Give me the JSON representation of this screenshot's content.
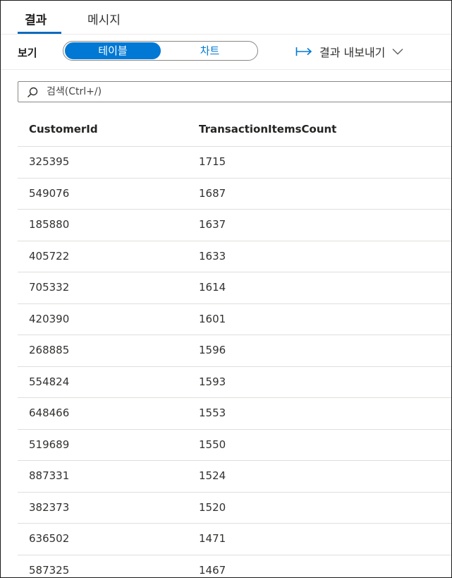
{
  "tabs": [
    {
      "label": "결과",
      "active": true
    },
    {
      "label": "메시지",
      "active": false
    }
  ],
  "toolbar": {
    "view_label": "보기",
    "view_options": [
      {
        "label": "테이블",
        "selected": true
      },
      {
        "label": "차트",
        "selected": false
      }
    ],
    "export_label": "결과 내보내기",
    "export_icon": "arrow-to-right-icon",
    "export_chevron": "chevron-down-icon"
  },
  "search": {
    "placeholder": "검색(Ctrl+/)",
    "value": "",
    "icon": "search-icon"
  },
  "table": {
    "columns": [
      "CustomerId",
      "TransactionItemsCount"
    ],
    "rows": [
      [
        "325395",
        "1715"
      ],
      [
        "549076",
        "1687"
      ],
      [
        "185880",
        "1637"
      ],
      [
        "405722",
        "1633"
      ],
      [
        "705332",
        "1614"
      ],
      [
        "420390",
        "1601"
      ],
      [
        "268885",
        "1596"
      ],
      [
        "554824",
        "1593"
      ],
      [
        "648466",
        "1553"
      ],
      [
        "519689",
        "1550"
      ],
      [
        "887331",
        "1524"
      ],
      [
        "382373",
        "1520"
      ],
      [
        "636502",
        "1471"
      ],
      [
        "587325",
        "1467"
      ]
    ]
  },
  "colors": {
    "accent": "#0078d4",
    "tab_underline": "#0f6cbd",
    "divider": "#e1dfdd"
  }
}
